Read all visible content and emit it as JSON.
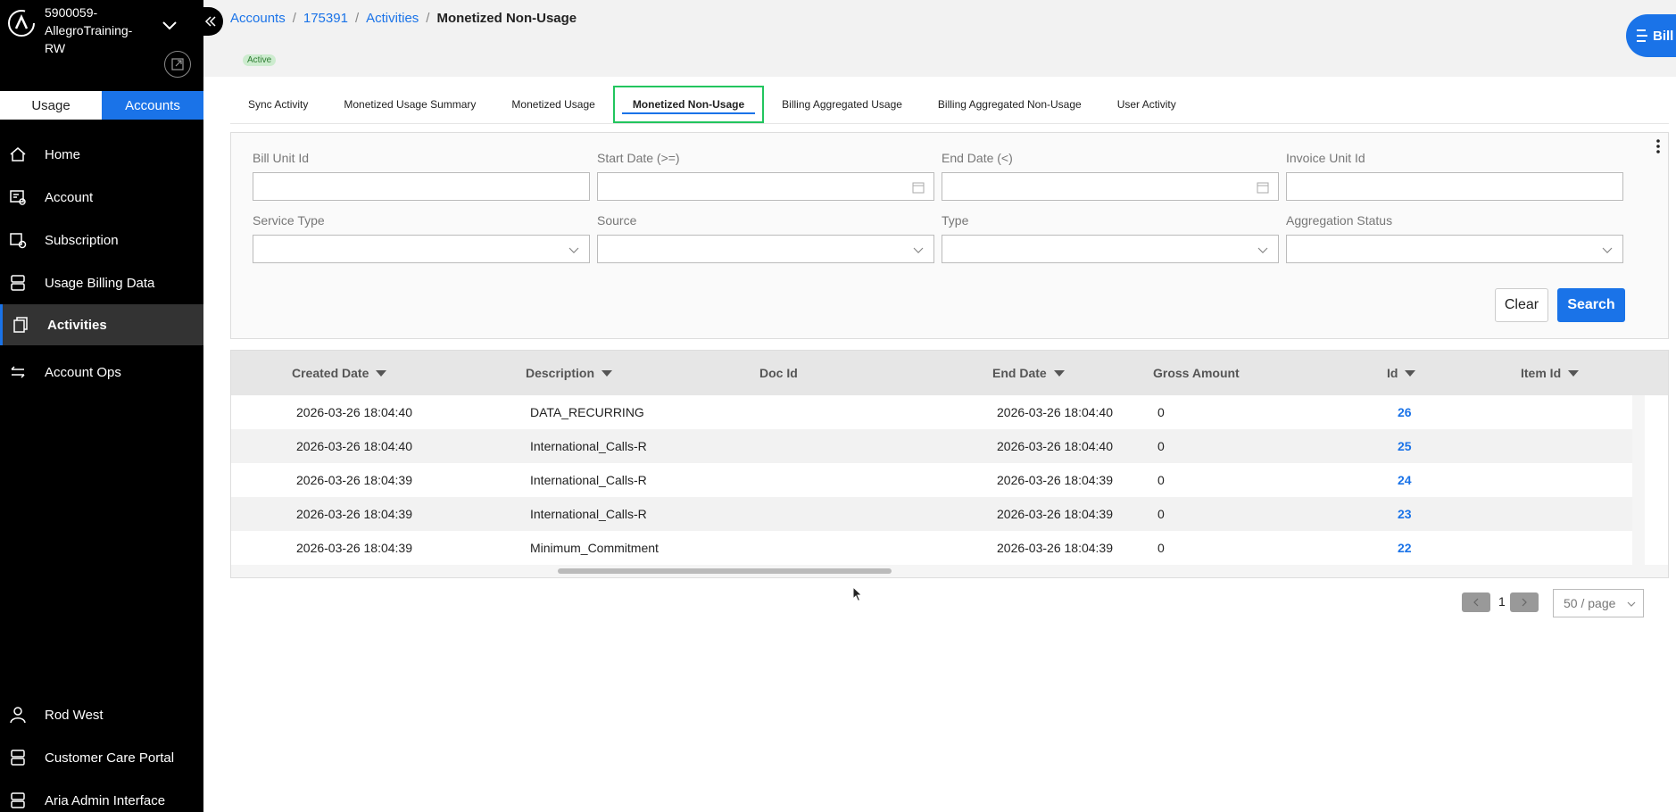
{
  "sidebar": {
    "tenant": "5900059-AllegroTraining-RW",
    "switch": {
      "usage": "Usage",
      "accounts": "Accounts"
    },
    "nav": [
      {
        "label": "Home",
        "icon": "home-icon"
      },
      {
        "label": "Account",
        "icon": "account-card-icon"
      },
      {
        "label": "Subscription",
        "icon": "subscription-icon"
      },
      {
        "label": "Usage Billing Data",
        "icon": "server-stack-icon"
      },
      {
        "label": "Activities",
        "icon": "copy-stack-icon",
        "active": true
      },
      {
        "label": "Account Ops",
        "icon": "arrows-swap-icon"
      }
    ],
    "bottom": [
      {
        "label": "Rod West",
        "icon": "user-icon"
      },
      {
        "label": "Customer Care Portal",
        "icon": "server-stack-icon"
      },
      {
        "label": "Aria Admin Interface",
        "icon": "server-stack-icon"
      }
    ]
  },
  "header": {
    "breadcrumb": [
      "Accounts",
      "175391",
      "Activities",
      "Monetized Non-Usage"
    ],
    "status_badge": "Active",
    "avatar_text": "Bill"
  },
  "tabs": [
    "Sync Activity",
    "Monetized Usage Summary",
    "Monetized Usage",
    "Monetized Non-Usage",
    "Billing Aggregated Usage",
    "Billing Aggregated Non-Usage",
    "User Activity"
  ],
  "active_tab": "Monetized Non-Usage",
  "filters": {
    "bill_unit_id": {
      "label": "Bill Unit Id",
      "value": ""
    },
    "start_date": {
      "label": "Start Date (>=)",
      "value": ""
    },
    "end_date": {
      "label": "End Date (<)",
      "value": ""
    },
    "invoice_unit_id": {
      "label": "Invoice Unit Id",
      "value": ""
    },
    "service_type": {
      "label": "Service Type",
      "value": ""
    },
    "source": {
      "label": "Source",
      "value": ""
    },
    "type": {
      "label": "Type",
      "value": ""
    },
    "aggregation_status": {
      "label": "Aggregation Status",
      "value": ""
    },
    "clear_label": "Clear",
    "search_label": "Search"
  },
  "table": {
    "columns": [
      "Created Date",
      "Description",
      "Doc Id",
      "End Date",
      "Gross Amount",
      "Id",
      "Item Id"
    ],
    "rows": [
      {
        "created": "2026-03-26 18:04:40",
        "description": "DATA_RECURRING",
        "doc_id": "",
        "end": "2026-03-26 18:04:40",
        "gross": "0",
        "id": "26",
        "item_id": ""
      },
      {
        "created": "2026-03-26 18:04:40",
        "description": "International_Calls-R",
        "doc_id": "",
        "end": "2026-03-26 18:04:40",
        "gross": "0",
        "id": "25",
        "item_id": ""
      },
      {
        "created": "2026-03-26 18:04:39",
        "description": "International_Calls-R",
        "doc_id": "",
        "end": "2026-03-26 18:04:39",
        "gross": "0",
        "id": "24",
        "item_id": ""
      },
      {
        "created": "2026-03-26 18:04:39",
        "description": "International_Calls-R",
        "doc_id": "",
        "end": "2026-03-26 18:04:39",
        "gross": "0",
        "id": "23",
        "item_id": ""
      },
      {
        "created": "2026-03-26 18:04:39",
        "description": "Minimum_Commitment",
        "doc_id": "",
        "end": "2026-03-26 18:04:39",
        "gross": "0",
        "id": "22",
        "item_id": ""
      }
    ]
  },
  "pagination": {
    "current_page": "1",
    "page_size": "50 / page"
  }
}
